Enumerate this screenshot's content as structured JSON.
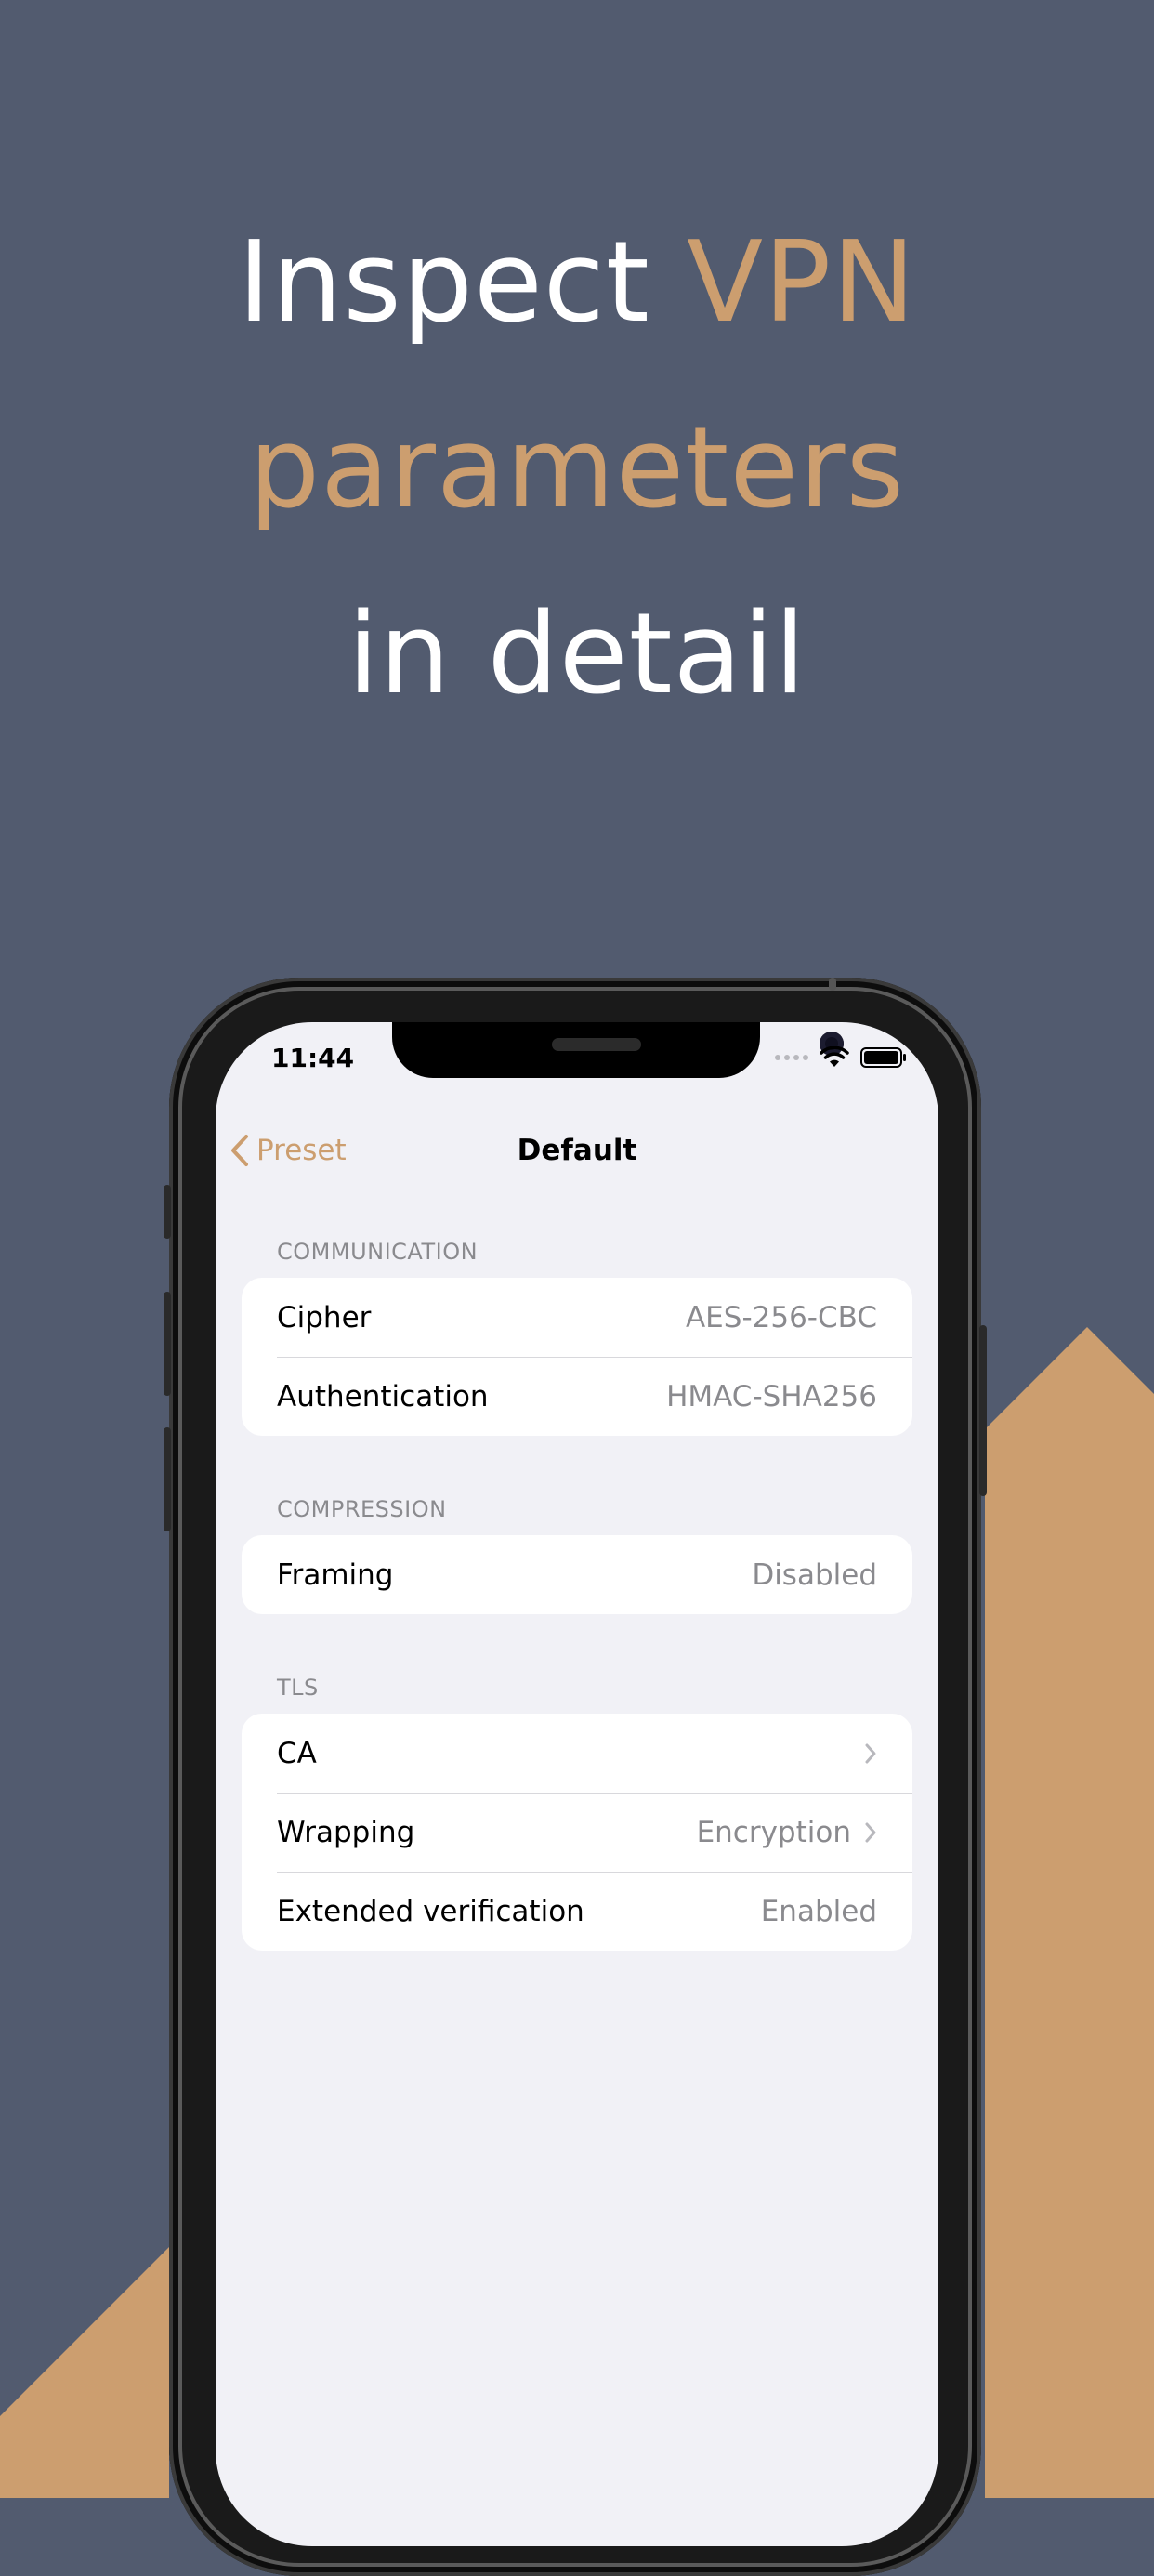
{
  "headline": {
    "line1_white": "Inspect ",
    "line1_accent": "VPN",
    "line2_accent": "parameters",
    "line3_white": "in detail"
  },
  "colors": {
    "background": "#525b6f",
    "accent": "#cc9e6f",
    "screen_background": "#f1f1f6"
  },
  "status_bar": {
    "time": "11:44",
    "icons": [
      "signal-dots-icon",
      "wifi-icon",
      "battery-icon"
    ]
  },
  "nav": {
    "back_label": "Preset",
    "title": "Default"
  },
  "sections": [
    {
      "header": "COMMUNICATION",
      "rows": [
        {
          "label": "Cipher",
          "value": "AES-256-CBC"
        },
        {
          "label": "Authentication",
          "value": "HMAC-SHA256"
        }
      ]
    },
    {
      "header": "COMPRESSION",
      "rows": [
        {
          "label": "Framing",
          "value": "Disabled"
        }
      ]
    },
    {
      "header": "TLS",
      "rows": [
        {
          "label": "CA",
          "value": "",
          "chevron": true
        },
        {
          "label": "Wrapping",
          "value": "Encryption",
          "chevron": true
        },
        {
          "label": "Extended verification",
          "value": "Enabled"
        }
      ]
    }
  ]
}
